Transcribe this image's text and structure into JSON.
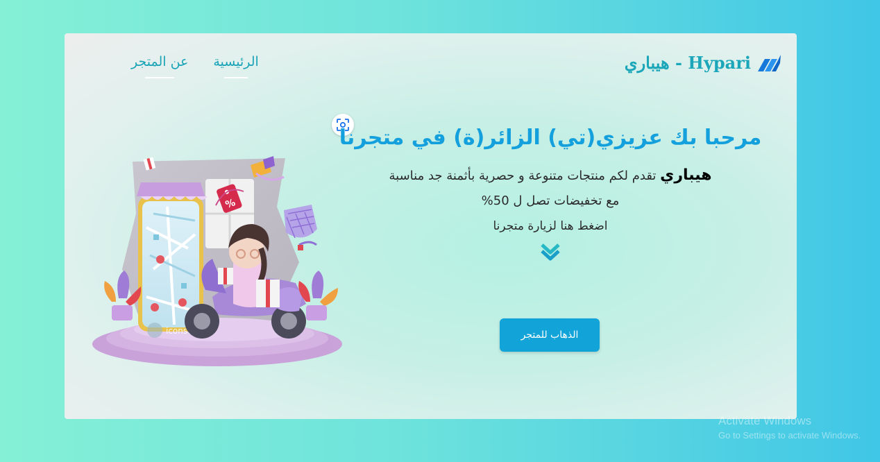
{
  "brand": {
    "name": "هيباري - Hypari",
    "logo_icon": "hypari-logo-icon",
    "color": "#1ba6b9"
  },
  "nav": {
    "items": [
      {
        "label": "الرئيسية"
      },
      {
        "label": "عن المتجر"
      }
    ]
  },
  "hero": {
    "title": "مرحبا بك عزيزي(تي) الزائر(ة) في متجرنا",
    "line1_brand": "هيباري",
    "line1_text": " تقدم لكم منتجات متنوعة و حصرية بأثمنة جد مناسبة",
    "line2": "مع تخفيضات تصل ل 50%",
    "line3": "اضغط هنا لزيارة متجرنا",
    "cta_label": "الذهاب للمتجر",
    "title_color": "#14a0dc",
    "cta_color": "#12a4d8"
  },
  "illustration": {
    "watermark_text": "iconscout"
  },
  "os_overlay": {
    "line1": "Activate Windows",
    "line2": "Go to Settings to activate Windows."
  }
}
